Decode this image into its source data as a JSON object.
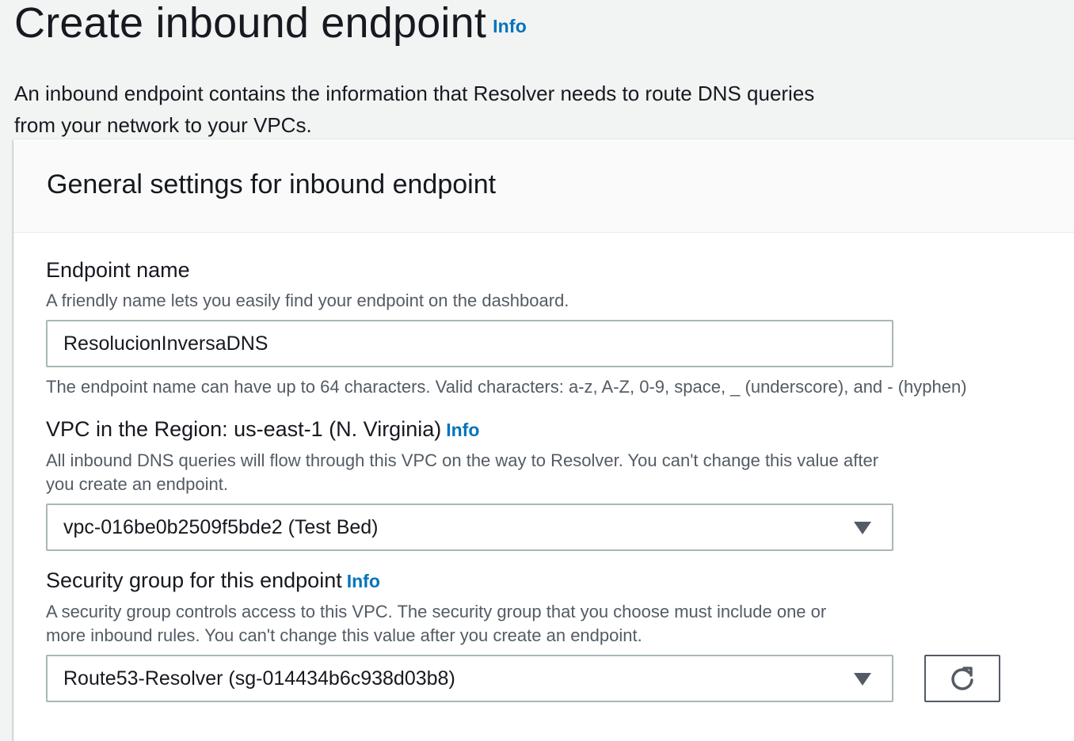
{
  "page": {
    "title": "Create inbound endpoint",
    "title_info": "Info",
    "description": "An inbound endpoint contains the information that Resolver needs to route DNS queries from your network to your VPCs."
  },
  "panel": {
    "title": "General settings for inbound endpoint"
  },
  "endpoint_name": {
    "label": "Endpoint name",
    "description": "A friendly name lets you easily find your endpoint on the dashboard.",
    "value": "ResolucionInversaDNS",
    "constraint": "The endpoint name can have up to 64 characters. Valid characters: a-z, A-Z, 0-9, space, _ (underscore), and - (hyphen)"
  },
  "vpc": {
    "label": "VPC in the Region: us-east-1 (N. Virginia)",
    "info": "Info",
    "description": "All inbound DNS queries will flow through this VPC on the way to Resolver. You can't change this value after you create an endpoint.",
    "selected": "vpc-016be0b2509f5bde2 (Test Bed)"
  },
  "security_group": {
    "label": "Security group for this endpoint",
    "info": "Info",
    "description": "A security group controls access to this VPC. The security group that you choose must include one or more inbound rules. You can't change this value after you create an endpoint.",
    "selected": "Route53-Resolver (sg-014434b6c938d03b8)",
    "refresh_icon": "refresh-icon"
  },
  "colors": {
    "link": "#0073bb",
    "text": "#16191f",
    "secondary_text": "#545b64",
    "border": "#aab7b8",
    "background": "#f2f3f3"
  }
}
